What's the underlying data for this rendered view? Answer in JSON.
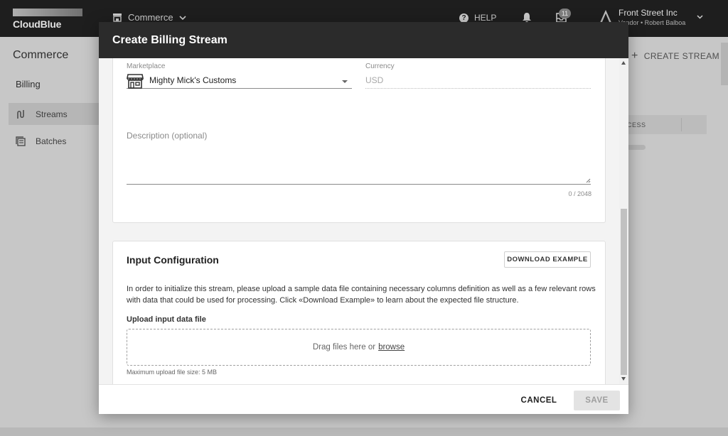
{
  "topbar": {
    "brand": "CloudBlue",
    "module": "Commerce",
    "help_label": "HELP",
    "notifications_count": "11",
    "account_name": "Front Street Inc",
    "account_sub": "Vendor • Robert Balboa"
  },
  "page": {
    "title": "Commerce",
    "section": "Billing",
    "nav_items": [
      {
        "label": "Streams",
        "icon": "streams-icon"
      },
      {
        "label": "Batches",
        "icon": "batches-icon"
      }
    ],
    "create_stream_label": "CREATE STREAM",
    "table_header_partial": "CESS"
  },
  "dialog": {
    "title": "Create Billing Stream",
    "marketplace": {
      "label": "Marketplace",
      "value": "Mighty Mick's Customs"
    },
    "currency": {
      "label": "Currency",
      "value": "USD"
    },
    "description": {
      "label": "Description (optional)",
      "counter": "0 / 2048"
    },
    "input_config": {
      "title": "Input Configuration",
      "download_example_label": "DOWNLOAD EXAMPLE",
      "description": "In order to initialize this stream, please upload a sample data file containing necessary columns definition as well as a few relevant rows with data that could be used for processing. Click «Download Example» to learn about the expected file structure.",
      "upload_label": "Upload input data file",
      "dropzone_text": "Drag files here or",
      "browse_label": "browse",
      "max_size": "Maximum upload file size: 5 MB"
    },
    "footer": {
      "cancel_label": "CANCEL",
      "save_label": "SAVE"
    }
  }
}
